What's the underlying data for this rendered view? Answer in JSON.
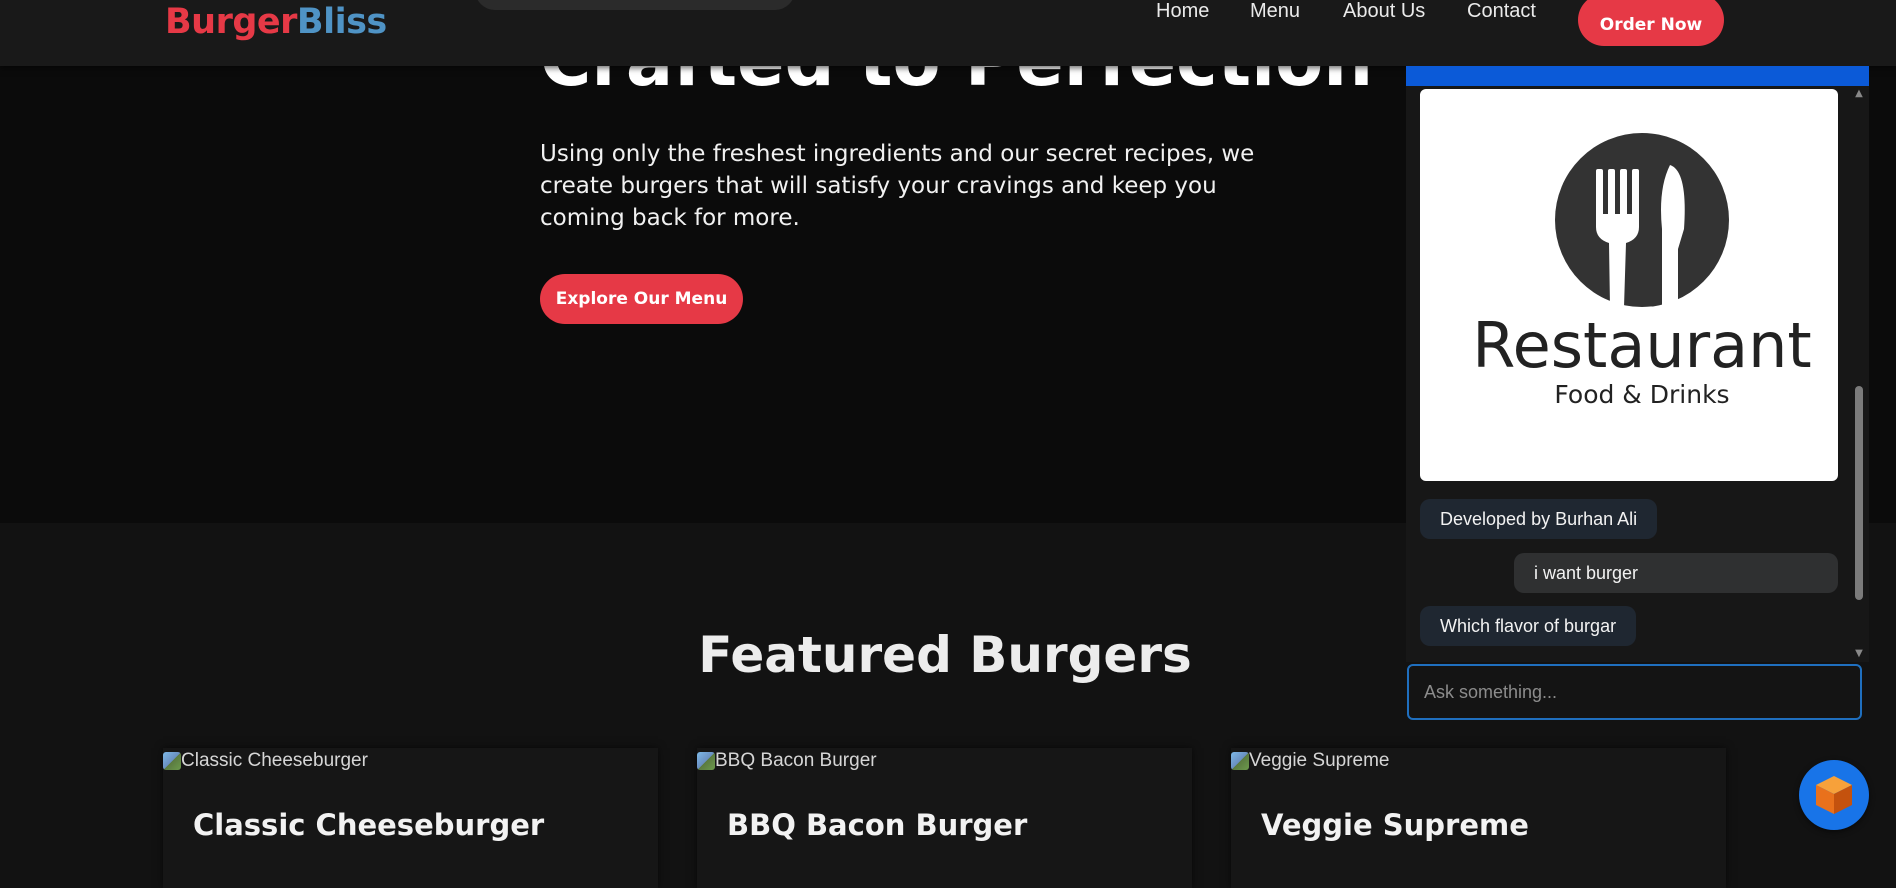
{
  "nav": {
    "logo_part1": "Burger",
    "logo_part2": "Bliss",
    "links": [
      "Home",
      "Menu",
      "About Us",
      "Contact"
    ],
    "order_button": "Order Now"
  },
  "hero": {
    "title": "Crafted to Perfection",
    "description": "Using only the freshest ingredients and our secret recipes, we create burgers that will satisfy your cravings and keep you coming back for more.",
    "button": "Explore Our Menu"
  },
  "featured": {
    "title": "Featured Burgers",
    "cards": [
      {
        "alt": "Classic Cheeseburger",
        "title": "Classic Cheeseburger"
      },
      {
        "alt": "BBQ Bacon Burger",
        "title": "BBQ Bacon Burger"
      },
      {
        "alt": "Veggie Supreme",
        "title": "Veggie Supreme"
      }
    ]
  },
  "chat": {
    "logo_title": "Restaurant",
    "logo_subtitle": "Food & Drinks",
    "messages": [
      {
        "role": "bot",
        "text": "Developed by Burhan Ali"
      },
      {
        "role": "user",
        "text": "i want burger"
      },
      {
        "role": "bot",
        "text": "Which flavor of burgar"
      }
    ],
    "input_placeholder": "Ask something...",
    "header_color": "#0b5ad8"
  },
  "colors": {
    "accent": "#e63946",
    "logo_blue": "#4f93c5",
    "fab": "#1874e8"
  },
  "icons": {
    "restaurant_logo": "fork-knife-icon",
    "fab": "cube-icon",
    "broken_image": "broken-image-icon"
  }
}
